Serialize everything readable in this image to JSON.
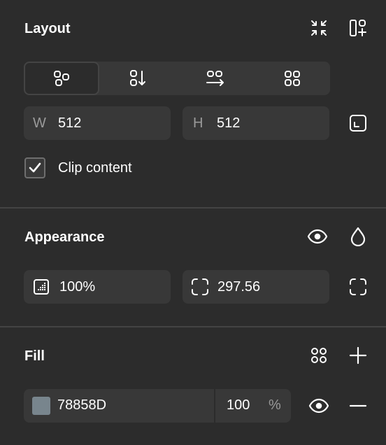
{
  "layout": {
    "title": "Layout",
    "dimensions": {
      "width_label": "W",
      "width_value": "512",
      "height_label": "H",
      "height_value": "512"
    },
    "clip": {
      "label": "Clip content",
      "checked": true
    }
  },
  "appearance": {
    "title": "Appearance",
    "opacity": "100%",
    "corner_radius": "297.56"
  },
  "fill": {
    "title": "Fill",
    "color_hex": "78858D",
    "swatch_color": "#78858D",
    "opacity": "100",
    "percent_sign": "%"
  }
}
